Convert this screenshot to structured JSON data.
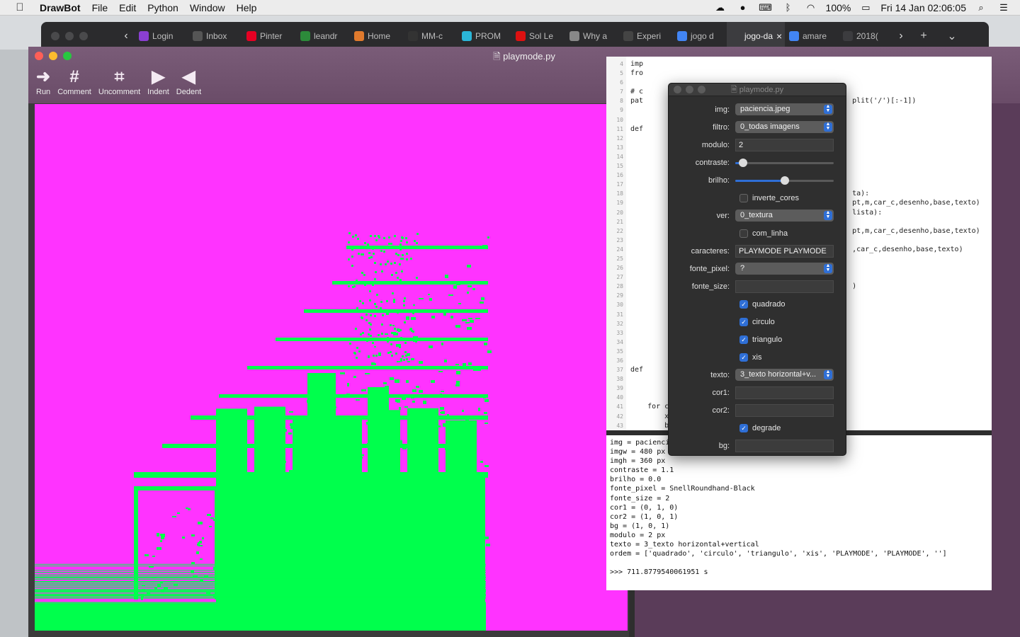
{
  "menubar": {
    "app": "DrawBot",
    "items": [
      "File",
      "Edit",
      "Python",
      "Window",
      "Help"
    ],
    "battery": "100%",
    "datetime": "Fri 14 Jan  02:06:05"
  },
  "browser": {
    "tabs": [
      "Login",
      "Inbox",
      "Pinter",
      "leandr",
      "Home",
      "MM-c",
      "PROM",
      "Sol Le",
      "Why a",
      "Experi",
      "jogo d",
      "jogo-da",
      "amare",
      "2018("
    ],
    "tab_colors": [
      "#8a3fd1",
      "#555",
      "#e60023",
      "#2c8a3a",
      "#e07a2d",
      "#333",
      "#2bb6d8",
      "#d11",
      "#888",
      "#444",
      "#4285f4",
      "#3c3c3f",
      "#4285f4",
      "#3c3c3f"
    ]
  },
  "window": {
    "title": "playmode.py",
    "toolbar": [
      {
        "label": "Run",
        "icon": "run-icon",
        "glyph": "➜"
      },
      {
        "label": "Comment",
        "icon": "comment-icon",
        "glyph": "#"
      },
      {
        "label": "Uncomment",
        "icon": "uncomment-icon",
        "glyph": "⌗"
      },
      {
        "label": "Indent",
        "icon": "indent-icon",
        "glyph": "▶"
      },
      {
        "label": "Dedent",
        "icon": "dedent-icon",
        "glyph": "◀"
      }
    ]
  },
  "editor": {
    "line_start": 4,
    "line_end": 43,
    "visible_code": [
      {
        "line": 4,
        "text": "imp"
      },
      {
        "line": 5,
        "text": "fro"
      },
      {
        "line": 7,
        "text": "# c"
      },
      {
        "line": 8,
        "text": "pat                                                 plit('/')[:-1])"
      },
      {
        "line": 11,
        "text": "def"
      },
      {
        "line": 18,
        "text": "                                                    ta):"
      },
      {
        "line": 19,
        "text": "                                                    pt,m,car_c,desenho,base,texto)"
      },
      {
        "line": 20,
        "text": "                                                    lista):"
      },
      {
        "line": 22,
        "text": "                                                    pt,m,car_c,desenho,base,texto)"
      },
      {
        "line": 24,
        "text": "                                                    ,car_c,desenho,base,texto)"
      },
      {
        "line": 28,
        "text": "                                                    )"
      },
      {
        "line": 37,
        "text": "def"
      },
      {
        "line": 41,
        "text": "    for c in car_lista:"
      },
      {
        "line": 42,
        "text": "        x,y=0,0"
      },
      {
        "line": 43,
        "text": "        bezier=BezierPath()"
      }
    ]
  },
  "console": {
    "lines": [
      "img = paciencia.jpeg",
      "imgw = 480 px",
      "imgh = 360 px",
      "contraste = 1.1",
      "brilho = 0.0",
      "fonte_pixel = SnellRoundhand-Black",
      "fonte_size = 2",
      "cor1 = (0, 1, 0)",
      "cor2 = (1, 0, 1)",
      "bg = (1, 0, 1)",
      "modulo = 2 px",
      "texto = 3_texto horizontal+vertical",
      "ordem = ['quadrado', 'circulo', 'triangulo', 'xis', 'PLAYMODE', 'PLAYMODE', '']",
      "",
      ">>> 711.8779540061951 s"
    ]
  },
  "panel": {
    "title": "playmode.py",
    "img_label": "img:",
    "img_value": "paciencia.jpeg",
    "filtro_label": "filtro:",
    "filtro_value": "0_todas imagens",
    "modulo_label": "modulo:",
    "modulo_value": "2",
    "contraste_label": "contraste:",
    "contraste_level": 0.08,
    "brilho_label": "brilho:",
    "brilho_level": 0.5,
    "inverte_label": "inverte_cores",
    "inverte_checked": false,
    "ver_label": "ver:",
    "ver_value": "0_textura",
    "com_linha_label": "com_linha",
    "com_linha_checked": false,
    "caracteres_label": "caracteres:",
    "caracteres_value": "PLAYMODE PLAYMODE",
    "fonte_pixel_label": "fonte_pixel:",
    "fonte_pixel_value": "?",
    "fonte_size_label": "fonte_size:",
    "fonte_size_value": "",
    "quadrado_label": "quadrado",
    "quadrado_checked": true,
    "circulo_label": "circulo",
    "circulo_checked": true,
    "triangulo_label": "triangulo",
    "triangulo_checked": true,
    "xis_label": "xis",
    "xis_checked": true,
    "texto_label": "texto:",
    "texto_value": "3_texto horizontal+v...",
    "cor1_label": "cor1:",
    "cor1_value": "",
    "cor2_label": "cor2:",
    "cor2_value": "",
    "degrade_label": "degrade",
    "degrade_checked": true,
    "bg_label": "bg:",
    "bg_value": ""
  },
  "colors": {
    "canvas_bg": "#ff33ff",
    "canvas_fg": "#00ff4c",
    "accent": "#2f6fd6"
  }
}
